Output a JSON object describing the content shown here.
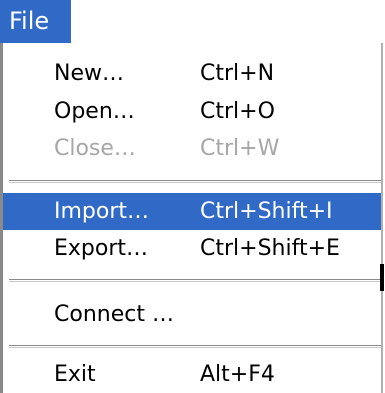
{
  "menubar": {
    "title": "File"
  },
  "menu": {
    "items": [
      {
        "label": "New…",
        "shortcut": "Ctrl+N"
      },
      {
        "label": "Open…",
        "shortcut": "Ctrl+O"
      },
      {
        "label": "Close…",
        "shortcut": "Ctrl+W",
        "disabled": true
      },
      {
        "label": "Import…",
        "shortcut": "Ctrl+Shift+I",
        "highlighted": true
      },
      {
        "label": "Export…",
        "shortcut": "Ctrl+Shift+E"
      },
      {
        "label": "Connect …"
      },
      {
        "label": "Exit",
        "shortcut": "Alt+F4"
      }
    ]
  },
  "colors": {
    "highlight": "#3169c6",
    "disabled_text": "#a7a7a7"
  }
}
